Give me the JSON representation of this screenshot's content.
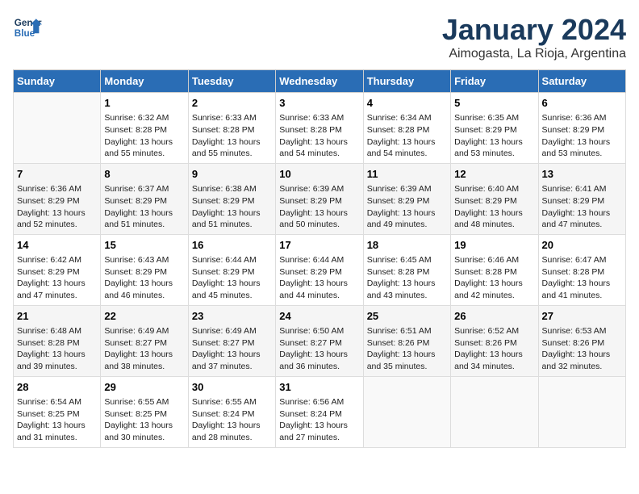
{
  "logo": {
    "line1": "General",
    "line2": "Blue"
  },
  "title": "January 2024",
  "subtitle": "Aimogasta, La Rioja, Argentina",
  "days_header": [
    "Sunday",
    "Monday",
    "Tuesday",
    "Wednesday",
    "Thursday",
    "Friday",
    "Saturday"
  ],
  "weeks": [
    [
      {
        "day": "",
        "info": ""
      },
      {
        "day": "1",
        "info": "Sunrise: 6:32 AM\nSunset: 8:28 PM\nDaylight: 13 hours\nand 55 minutes."
      },
      {
        "day": "2",
        "info": "Sunrise: 6:33 AM\nSunset: 8:28 PM\nDaylight: 13 hours\nand 55 minutes."
      },
      {
        "day": "3",
        "info": "Sunrise: 6:33 AM\nSunset: 8:28 PM\nDaylight: 13 hours\nand 54 minutes."
      },
      {
        "day": "4",
        "info": "Sunrise: 6:34 AM\nSunset: 8:28 PM\nDaylight: 13 hours\nand 54 minutes."
      },
      {
        "day": "5",
        "info": "Sunrise: 6:35 AM\nSunset: 8:29 PM\nDaylight: 13 hours\nand 53 minutes."
      },
      {
        "day": "6",
        "info": "Sunrise: 6:36 AM\nSunset: 8:29 PM\nDaylight: 13 hours\nand 53 minutes."
      }
    ],
    [
      {
        "day": "7",
        "info": "Sunrise: 6:36 AM\nSunset: 8:29 PM\nDaylight: 13 hours\nand 52 minutes."
      },
      {
        "day": "8",
        "info": "Sunrise: 6:37 AM\nSunset: 8:29 PM\nDaylight: 13 hours\nand 51 minutes."
      },
      {
        "day": "9",
        "info": "Sunrise: 6:38 AM\nSunset: 8:29 PM\nDaylight: 13 hours\nand 51 minutes."
      },
      {
        "day": "10",
        "info": "Sunrise: 6:39 AM\nSunset: 8:29 PM\nDaylight: 13 hours\nand 50 minutes."
      },
      {
        "day": "11",
        "info": "Sunrise: 6:39 AM\nSunset: 8:29 PM\nDaylight: 13 hours\nand 49 minutes."
      },
      {
        "day": "12",
        "info": "Sunrise: 6:40 AM\nSunset: 8:29 PM\nDaylight: 13 hours\nand 48 minutes."
      },
      {
        "day": "13",
        "info": "Sunrise: 6:41 AM\nSunset: 8:29 PM\nDaylight: 13 hours\nand 47 minutes."
      }
    ],
    [
      {
        "day": "14",
        "info": "Sunrise: 6:42 AM\nSunset: 8:29 PM\nDaylight: 13 hours\nand 47 minutes."
      },
      {
        "day": "15",
        "info": "Sunrise: 6:43 AM\nSunset: 8:29 PM\nDaylight: 13 hours\nand 46 minutes."
      },
      {
        "day": "16",
        "info": "Sunrise: 6:44 AM\nSunset: 8:29 PM\nDaylight: 13 hours\nand 45 minutes."
      },
      {
        "day": "17",
        "info": "Sunrise: 6:44 AM\nSunset: 8:29 PM\nDaylight: 13 hours\nand 44 minutes."
      },
      {
        "day": "18",
        "info": "Sunrise: 6:45 AM\nSunset: 8:28 PM\nDaylight: 13 hours\nand 43 minutes."
      },
      {
        "day": "19",
        "info": "Sunrise: 6:46 AM\nSunset: 8:28 PM\nDaylight: 13 hours\nand 42 minutes."
      },
      {
        "day": "20",
        "info": "Sunrise: 6:47 AM\nSunset: 8:28 PM\nDaylight: 13 hours\nand 41 minutes."
      }
    ],
    [
      {
        "day": "21",
        "info": "Sunrise: 6:48 AM\nSunset: 8:28 PM\nDaylight: 13 hours\nand 39 minutes."
      },
      {
        "day": "22",
        "info": "Sunrise: 6:49 AM\nSunset: 8:27 PM\nDaylight: 13 hours\nand 38 minutes."
      },
      {
        "day": "23",
        "info": "Sunrise: 6:49 AM\nSunset: 8:27 PM\nDaylight: 13 hours\nand 37 minutes."
      },
      {
        "day": "24",
        "info": "Sunrise: 6:50 AM\nSunset: 8:27 PM\nDaylight: 13 hours\nand 36 minutes."
      },
      {
        "day": "25",
        "info": "Sunrise: 6:51 AM\nSunset: 8:26 PM\nDaylight: 13 hours\nand 35 minutes."
      },
      {
        "day": "26",
        "info": "Sunrise: 6:52 AM\nSunset: 8:26 PM\nDaylight: 13 hours\nand 34 minutes."
      },
      {
        "day": "27",
        "info": "Sunrise: 6:53 AM\nSunset: 8:26 PM\nDaylight: 13 hours\nand 32 minutes."
      }
    ],
    [
      {
        "day": "28",
        "info": "Sunrise: 6:54 AM\nSunset: 8:25 PM\nDaylight: 13 hours\nand 31 minutes."
      },
      {
        "day": "29",
        "info": "Sunrise: 6:55 AM\nSunset: 8:25 PM\nDaylight: 13 hours\nand 30 minutes."
      },
      {
        "day": "30",
        "info": "Sunrise: 6:55 AM\nSunset: 8:24 PM\nDaylight: 13 hours\nand 28 minutes."
      },
      {
        "day": "31",
        "info": "Sunrise: 6:56 AM\nSunset: 8:24 PM\nDaylight: 13 hours\nand 27 minutes."
      },
      {
        "day": "",
        "info": ""
      },
      {
        "day": "",
        "info": ""
      },
      {
        "day": "",
        "info": ""
      }
    ]
  ]
}
